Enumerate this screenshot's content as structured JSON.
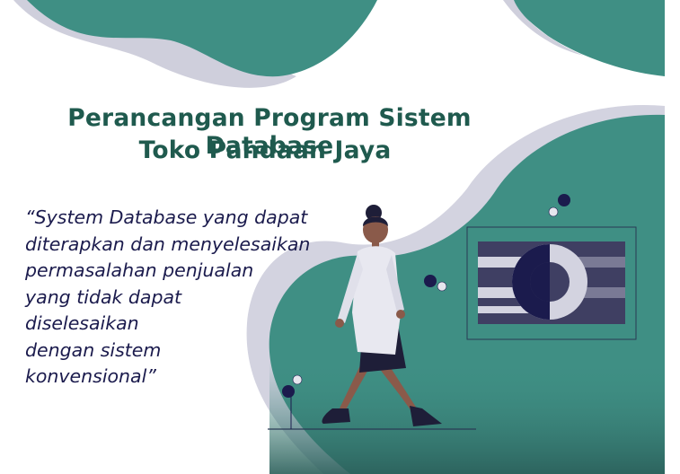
{
  "title": {
    "line1": "Perancangan Program Sistem Database",
    "line2": "Toko Pandaan Jaya"
  },
  "quote": {
    "lines": [
      "“System Database yang dapat",
      "diterapkan dan menyelesaikan",
      "permasalahan penjualan",
      "yang tidak dapat",
      "diselesaikan",
      "dengan sistem",
      "konvensional”"
    ]
  },
  "colors": {
    "teal": "#3f8f84",
    "teal_dark": "#2f7568",
    "lavender": "#cfcfdc",
    "navy": "#1b1b4d",
    "title": "#1f5a4e"
  },
  "illustration": {
    "figure": "woman-walking",
    "object": "camera-like-image-frame",
    "decor": [
      "bubble-icon",
      "bubble-icon",
      "bubble-icon",
      "bubble-icon"
    ]
  }
}
